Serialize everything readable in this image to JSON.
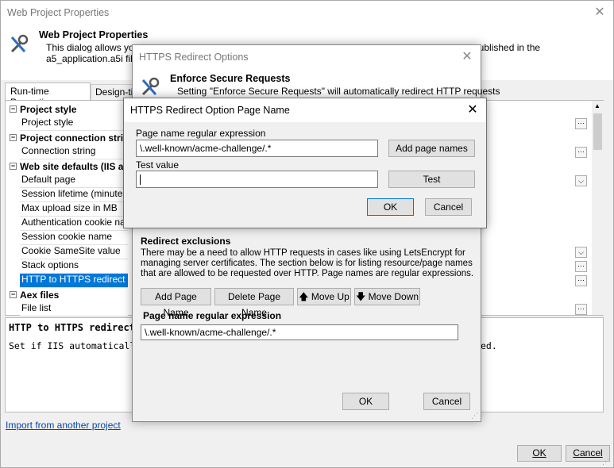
{
  "main": {
    "window_title": "Web Project Properties",
    "header_title": "Web Project Properties",
    "header_desc_line1": "This dialog allows you t",
    "header_desc_line2": "a5_application.a5i file.",
    "header_desc_tail": "published in the",
    "tabs": [
      "Run-time Properties",
      "Design-tim"
    ],
    "categories": [
      "Project style",
      "Project connection strin",
      "Web site defaults (IIS a",
      "Aex files"
    ],
    "props": [
      "Project style",
      "Connection string",
      "Default page",
      "Session lifetime (minutes)",
      "Max upload size in MB",
      "Authentication cookie name",
      "Session cookie name",
      "Cookie SameSite value",
      "Stack options",
      "HTTP to HTTPS redirect",
      "File list"
    ],
    "desc_title": "HTTP to HTTPS redirect",
    "desc_text": "Set if IIS automatically redi",
    "desc_tail": "ed.",
    "import_link": "Import from another project",
    "ok_label": "OK",
    "cancel_label": "Cancel"
  },
  "redirect_dialog": {
    "title": "HTTPS Redirect Options",
    "enforce_title": "Enforce Secure Requests",
    "enforce_desc": "Setting \"Enforce Secure Requests\" will automatically redirect HTTP requests",
    "exclusions_title": "Redirect exclusions",
    "exclusions_desc_1": "There may be a need to allow HTTP requests in cases like using LetsEncrypt for",
    "exclusions_desc_2": "managing server certificates. The section below is for listing resource/page names",
    "exclusions_desc_3": "that are allowed to be requested over HTTP. Page names are regular expressions.",
    "add_page_label": "Add Page Name",
    "delete_page_label": "Delete Page Name",
    "move_up_label": "Move Up",
    "move_down_label": "Move Down",
    "list_header": "Page name regular expression",
    "list_items": [
      "\\.well-known/acme-challenge/.*"
    ],
    "ok_label": "OK",
    "cancel_label": "Cancel"
  },
  "page_name_dialog": {
    "title": "HTTPS Redirect Option Page Name",
    "regex_label": "Page name regular expression",
    "regex_value": "\\.well-known/acme-challenge/.*",
    "add_names_label": "Add page names",
    "test_label": "Test value",
    "test_value": "",
    "test_button": "Test",
    "ok_label": "OK",
    "cancel_label": "Cancel"
  }
}
